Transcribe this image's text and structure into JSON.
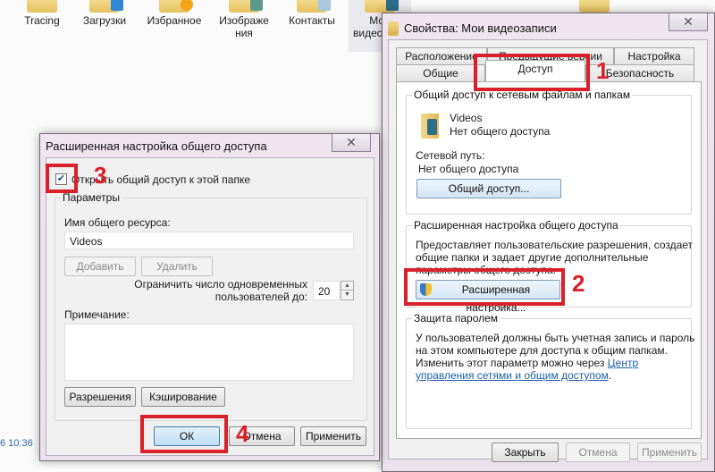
{
  "desktop": {
    "icons": [
      {
        "label": "Tracing",
        "icon": "folder-icon"
      },
      {
        "label": "Загрузки",
        "icon": "downloads-folder-icon"
      },
      {
        "label": "Избранное",
        "icon": "favorites-folder-icon"
      },
      {
        "label": "Изображения",
        "icon": "pictures-folder-icon"
      },
      {
        "label": "Контакты",
        "icon": "contacts-folder-icon"
      },
      {
        "label": "Мои видеозаписи",
        "icon": "videos-folder-icon"
      }
    ],
    "timestamp": "6 10:36"
  },
  "properties_dialog": {
    "title": "Свойства: Мои видеозаписи",
    "close_symbol": "✕",
    "tabs_row1": [
      "Расположение",
      "Предыдущие версии",
      "Настройка"
    ],
    "tabs_row2": [
      "Общие",
      "Доступ",
      "Безопасность"
    ],
    "active_tab": "Доступ",
    "network_share": {
      "group_label": "Общий доступ к сетевым файлам и папкам",
      "folder_name": "Videos",
      "folder_status": "Нет общего доступа",
      "network_path_label": "Сетевой путь:",
      "network_path_value": "Нет общего доступа",
      "share_button": "Общий доступ..."
    },
    "advanced_share": {
      "group_label": "Расширенная настройка общего доступа",
      "description_line1": "Предоставляет пользовательские разрешения, создает",
      "description_line2": "общие папки и задает другие дополнительные",
      "description_line3": "параметры общего доступа.",
      "button": "Расширенная настройка..."
    },
    "password_protection": {
      "group_label": "Защита паролем",
      "line1": "У пользователей должны быть учетная запись и пароль",
      "line2": "на этом компьютере для доступа к общим папкам.",
      "line3_prefix": "Изменить этот параметр можно через ",
      "link_part1": "Центр",
      "link_part2": "управления сетями и общим доступом",
      "line4_suffix": "."
    },
    "buttons": {
      "close": "Закрыть",
      "cancel": "Отмена",
      "apply": "Применить"
    }
  },
  "advanced_dialog": {
    "title": "Расширенная настройка общего доступа",
    "close_symbol": "✕",
    "share_checkbox_label": "Открыть общий доступ к этой папке",
    "share_checkbox_checked": true,
    "params_group_label": "Параметры",
    "share_name_label": "Имя общего ресурса:",
    "share_name_value": "Videos",
    "add_button": "Добавить",
    "remove_button": "Удалить",
    "limit_label_line1": "Ограничить число одновременных",
    "limit_label_line2": "пользователей до:",
    "limit_value": "20",
    "comment_label": "Примечание:",
    "comment_value": "",
    "permissions_button": "Разрешения",
    "caching_button": "Кэширование",
    "buttons": {
      "ok": "ОК",
      "cancel": "Отмена",
      "apply": "Применить"
    }
  },
  "annotations": {
    "step1": "1",
    "step2": "2",
    "step3": "3",
    "step4": "4",
    "color": "#d9202b"
  }
}
